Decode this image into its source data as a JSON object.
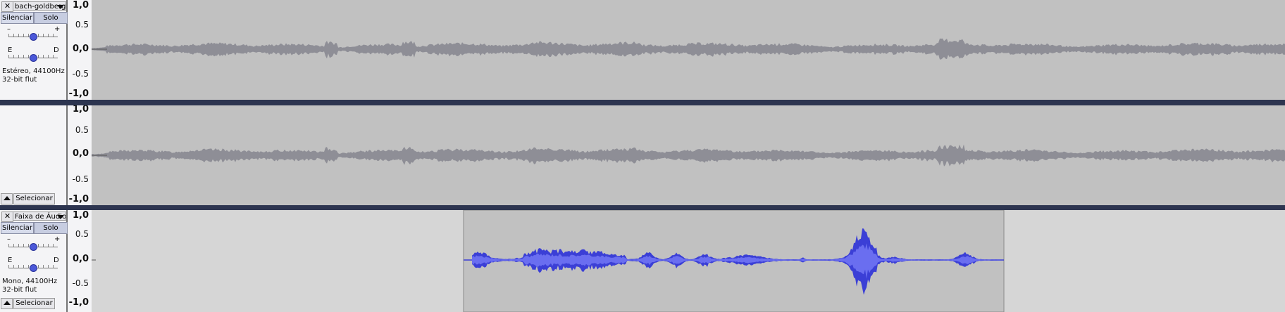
{
  "tracks": [
    {
      "name": "bach-goldberg",
      "close_symbol": "✕",
      "mute_label": "Silenciar",
      "solo_label": "Solo",
      "gain_minus": "–",
      "gain_plus": "+",
      "pan_left": "E",
      "pan_right": "D",
      "info_line1": "Estéreo, 44100Hz",
      "info_line2": "32-bit flut",
      "select_label": "Selecionar",
      "channels": 2,
      "ruler_ticks": [
        "1,0",
        "0.5",
        "0,0",
        "-0.5",
        "-1,0"
      ]
    },
    {
      "name": "Faixa de Áudio",
      "close_symbol": "✕",
      "mute_label": "Silenciar",
      "solo_label": "Solo",
      "gain_minus": "–",
      "gain_plus": "+",
      "pan_left": "E",
      "pan_right": "D",
      "info_line1": "Mono, 44100Hz",
      "info_line2": "32-bit flut",
      "select_label": "Selecionar",
      "channels": 1,
      "ruler_ticks": [
        "1,0",
        "0.5",
        "0,0",
        "-0.5",
        "-1,0"
      ]
    }
  ],
  "colors": {
    "clip_bg": "#c1c1c1",
    "track_bg": "#d6d6d6",
    "wave_gray": "#8e8e96",
    "wave_blue": "#3b3fd6",
    "wave_blue_rms": "#6a6ef0",
    "separator": "#2d3550"
  }
}
